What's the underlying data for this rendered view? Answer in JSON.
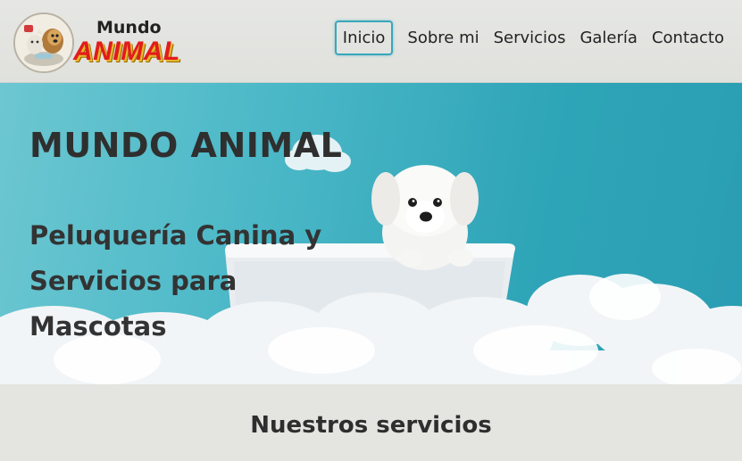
{
  "header": {
    "brand_top": "Mundo",
    "brand_main": "ANIMAL",
    "logo_icon": "dog-cat-logo-icon"
  },
  "nav": {
    "items": [
      {
        "label": "Inicio",
        "active": true
      },
      {
        "label": "Sobre mi",
        "active": false
      },
      {
        "label": "Servicios",
        "active": false
      },
      {
        "label": "Galería",
        "active": false
      },
      {
        "label": "Contacto",
        "active": false
      }
    ]
  },
  "hero": {
    "title": "MUNDO ANIMAL",
    "subtitle": "Peluquería Canina y Servicios para Mascotas",
    "image": "puppy-in-bathtub-image"
  },
  "services": {
    "title": "Nuestros servicios"
  },
  "colors": {
    "accent": "#38a7bb",
    "brand_red": "#e11c1c",
    "hero_blue": "#3aaebf"
  }
}
